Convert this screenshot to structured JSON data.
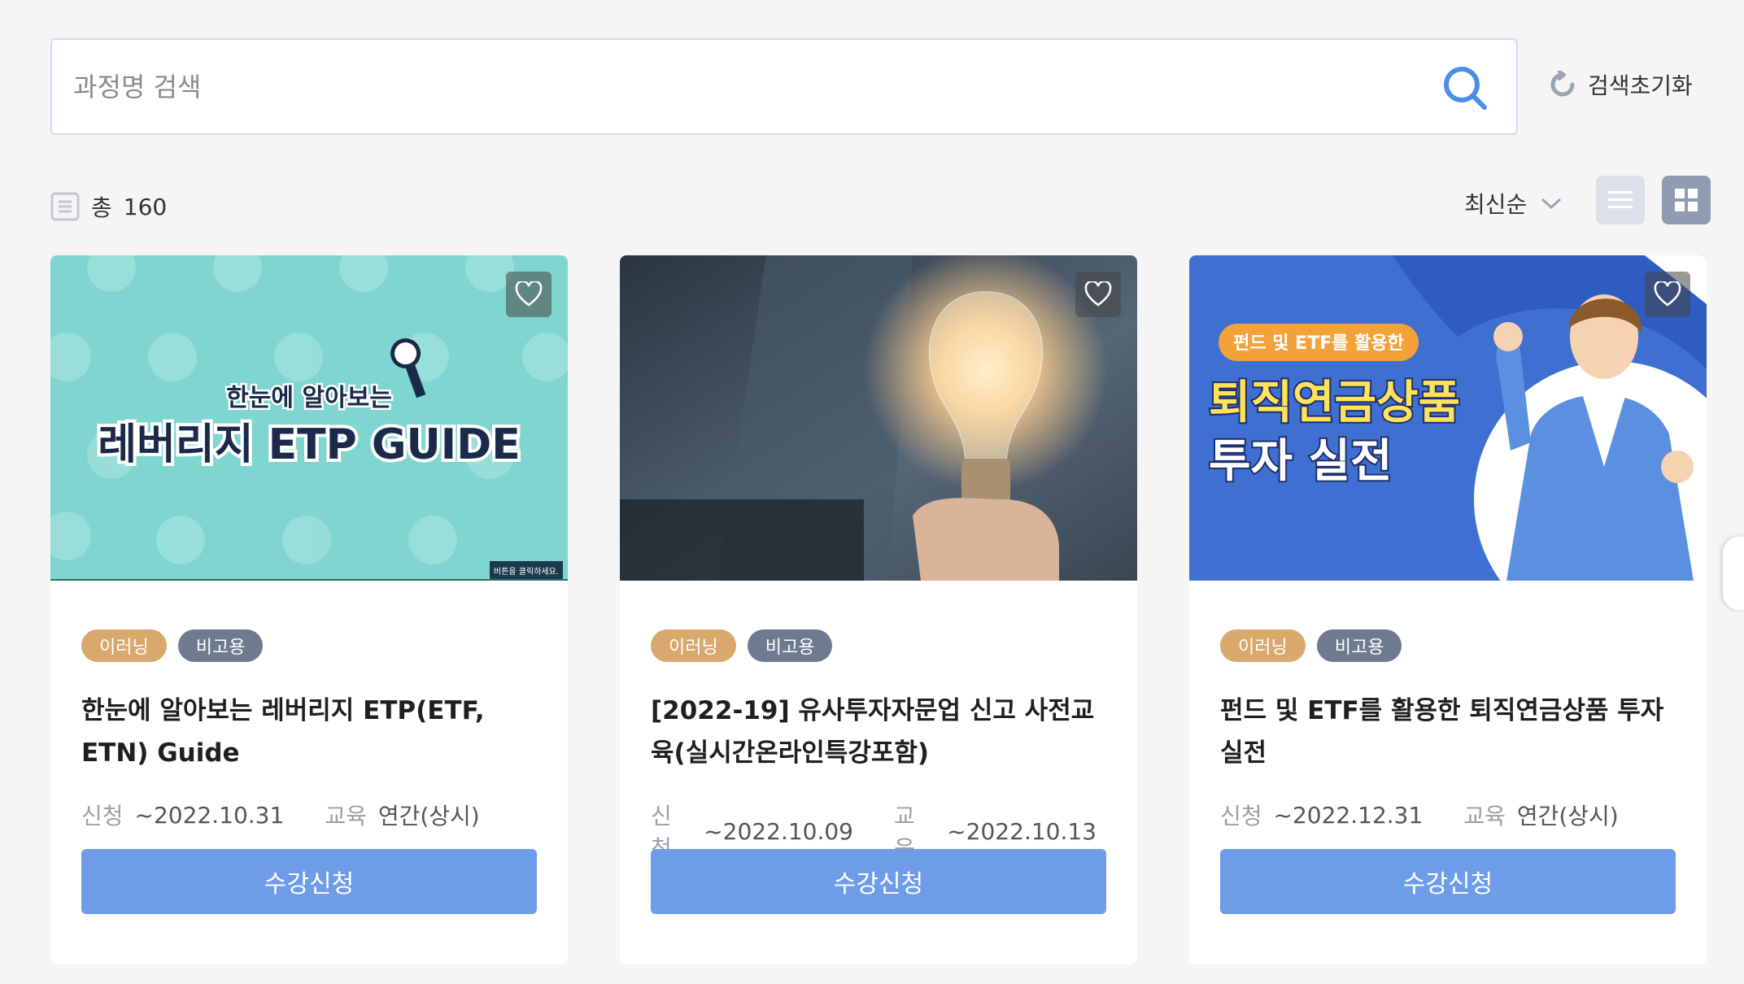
{
  "search": {
    "placeholder": "과정명 검색",
    "reset_label": "검색초기화"
  },
  "toolbar": {
    "total_label": "총",
    "total_count": "160",
    "sort_label": "최신순"
  },
  "colors": {
    "accent": "#6f9ce9",
    "badge_orange": "#d9a86c",
    "badge_gray": "#6e7b8f"
  },
  "courses": [
    {
      "image_text": {
        "line1": "한눈에 알아보는",
        "line2": "레버리지 ETP GUIDE",
        "corner": "버튼을 클릭하세요."
      },
      "badges": [
        "이러닝",
        "비고용"
      ],
      "title": "한눈에 알아보는 레버리지 ETP(ETF, ETN) Guide",
      "apply_key": "신청",
      "apply_date": "~2022.10.31",
      "edu_key": "교육",
      "edu_date": "연간(상시)",
      "button": "수강신청"
    },
    {
      "badges": [
        "이러닝",
        "비고용"
      ],
      "title": "[2022-19] 유사투자자문업 신고 사전교육(실시간온라인특강포함)",
      "apply_key": "신청",
      "apply_date": "~2022.10.09",
      "edu_key": "교육",
      "edu_date": "~2022.10.13",
      "button": "수강신청"
    },
    {
      "image_text": {
        "tag": "펀드 및 ETF를 활용한",
        "line1": "퇴직연금상품",
        "line2": "투자 실전"
      },
      "badges": [
        "이러닝",
        "비고용"
      ],
      "title": "펀드 및 ETF를 활용한 퇴직연금상품 투자 실전",
      "apply_key": "신청",
      "apply_date": "~2022.12.31",
      "edu_key": "교육",
      "edu_date": "연간(상시)",
      "button": "수강신청"
    }
  ]
}
